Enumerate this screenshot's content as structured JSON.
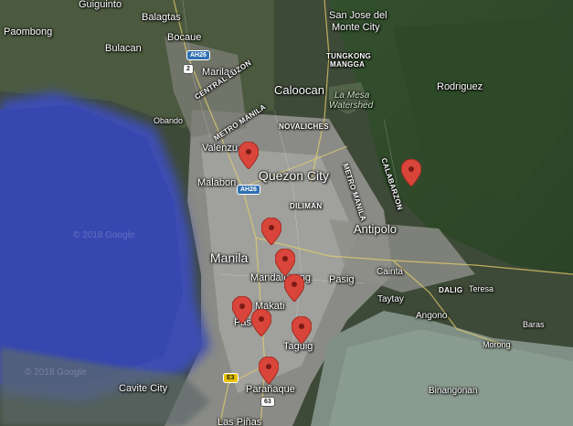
{
  "places": {
    "guiguinto": "Guiguinto",
    "balagtas": "Balagtas",
    "paombong": "Paombong",
    "bocaue": "Bocaue",
    "bulacan": "Bulacan",
    "san_jose": "San Jose del",
    "monte_city": "Monte City",
    "tungkong": "TUNGKONG",
    "mangga": "MANGGA",
    "marilao": "Marilao",
    "central_luzon": "CENTRAL LUZON",
    "caloocan": "Caloocan",
    "la_mesa": "La Mesa",
    "watershed": "Watershed",
    "rodriguez": "Rodriguez",
    "metro_manila_top": "METRO MANILA",
    "obando": "Obando",
    "novaliches": "NOVALICHES",
    "valenzuela": "Valenzu",
    "quezon_city": "Quezon City",
    "metro_manila_right": "METRO MANILA",
    "calabarzon": "CALABARZON",
    "malabon": "Malabon",
    "diliman": "DILIMAN",
    "antipolo": "Antipolo",
    "manila": "Manila",
    "mandaluyong": "Mandaluyong",
    "pasig": "Pasig",
    "cainta": "Cainta",
    "taytay": "Taytay",
    "dalig": "DALIG",
    "teresa": "Teresa",
    "makati": "Makati",
    "pasay": "Pas",
    "angono": "Angono",
    "baras": "Baras",
    "taguig": "Taguig",
    "morong": "Morong",
    "cavite_city": "Cavite City",
    "paranaque": "Parañaque",
    "binangonan": "Binangonan",
    "las_pinas": "Las Piñas"
  },
  "shields": {
    "ah26_top": "AH26",
    "route2": "2",
    "ah26_mid": "AH26",
    "e3": "E3",
    "route63": "63"
  },
  "watermarks": {
    "one": "© 2018 Google",
    "two": "© 2018 Google"
  },
  "markers": {
    "icon": "map-pin-icon",
    "color": "#d9453a",
    "count": 9
  },
  "colors": {
    "water": "#3a4db0",
    "bay": "#6a7a6a",
    "land": "#4a5a45",
    "urban": "#9a9c98",
    "mountain": "#3c5a34",
    "lake": "#8a9a8a"
  }
}
